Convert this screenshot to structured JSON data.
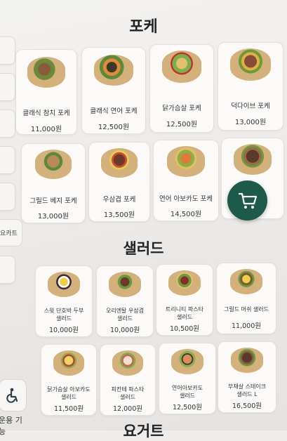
{
  "sections": {
    "poke_title": "포케",
    "salad_title": "샐러드",
    "yogurt_title": "요거트"
  },
  "poke_items": [
    {
      "name": "클래식 참치 포케",
      "price": "11,000원"
    },
    {
      "name": "클래식 연어 포케",
      "price": "12,500원"
    },
    {
      "name": "닭가슴살 포케",
      "price": "12,500원"
    },
    {
      "name": "덕다이브 포케",
      "price": "13,000원"
    },
    {
      "name": "그릴드 베지 포케",
      "price": "13,000원"
    },
    {
      "name": "우삼겹 포케",
      "price": "13,500원"
    },
    {
      "name": "연어 아보카도 포케",
      "price": "14,500원"
    },
    {
      "name": "",
      "price": ""
    }
  ],
  "salad_items": [
    {
      "name1": "스윗 단호박 두부",
      "name2": "샐러드",
      "price": "10,000원"
    },
    {
      "name1": "오리엔탈 우삼겹",
      "name2": "샐러드",
      "price": "10,000원"
    },
    {
      "name1": "트리니티 파스타",
      "name2": "샐러드",
      "price": "10,500원"
    },
    {
      "name1": "그릴드 머쉬 샐러드",
      "name2": "",
      "price": "11,000원"
    },
    {
      "name1": "닭가슴살 아보카도",
      "name2": "샐러드",
      "price": "11,500원"
    },
    {
      "name1": "피칸테 파스타",
      "name2": "샐러드",
      "price": "12,000원"
    },
    {
      "name1": "연어아보카도",
      "name2": "샐러드",
      "price": "12,500원"
    },
    {
      "name1": "부채살 스테이크",
      "name2": "샐러드 L",
      "price": "16,500원"
    }
  ],
  "side": {
    "tab_label": "요카트",
    "accessibility_label": "운용 기능"
  },
  "icons": {
    "cart": "cart-icon",
    "accessibility": "wheelchair-icon"
  },
  "colors": {
    "cart_button": "#1e5a4a",
    "background": "#efedeb",
    "card": "#fbfaf9"
  }
}
